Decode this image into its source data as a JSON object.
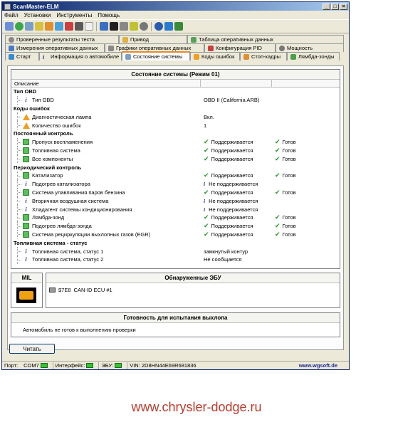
{
  "window": {
    "title": "ScanMaster-ELM",
    "min": "_",
    "max": "□",
    "close": "×"
  },
  "menu": [
    "Файл",
    "Установки",
    "Инструменты",
    "Помощь"
  ],
  "tabs_row1": [
    "Проверенные результаты теста",
    "Привод",
    "Таблица оперативных данных"
  ],
  "tabs_row2": [
    "Измерения оперативных данных",
    "Графики оперативных данных",
    "Конфигурация PID",
    "Мощность"
  ],
  "tabs_row3": [
    "Старт",
    "Информация о автомобиле",
    "Состояние системы",
    "Коды ошибок",
    "Стоп-кадры",
    "Лямбда-зонды"
  ],
  "status": {
    "header": "Состояние системы (Режим 01)",
    "col_desc": "Описание",
    "groups": [
      {
        "title": "Тип OBD",
        "rows": [
          {
            "icon": "info",
            "label": "Тип OBD",
            "value": "OBD II (California ARB)",
            "v_ok": false,
            "status": ""
          }
        ]
      },
      {
        "title": "Коды ошибок",
        "rows": [
          {
            "icon": "warn",
            "label": "Диагностическая лампа",
            "value": "Вкл.",
            "v_ok": false,
            "status": ""
          },
          {
            "icon": "warn",
            "label": "Количество ошибок",
            "value": "1",
            "v_ok": false,
            "status": ""
          }
        ]
      },
      {
        "title": "Постоянный контроль",
        "rows": [
          {
            "icon": "ok",
            "label": "Пропуск воспламенения",
            "value": "Поддерживается",
            "v_ok": true,
            "status": "Готов"
          },
          {
            "icon": "ok",
            "label": "Топливная система",
            "value": "Поддерживается",
            "v_ok": true,
            "status": "Готов"
          },
          {
            "icon": "ok",
            "label": "Все компоненты",
            "value": "Поддерживается",
            "v_ok": true,
            "status": "Готов"
          }
        ]
      },
      {
        "title": "Периодический контроль",
        "rows": [
          {
            "icon": "ok",
            "label": "Катализатор",
            "value": "Поддерживается",
            "v_ok": true,
            "status": "Готов"
          },
          {
            "icon": "info",
            "label": "Подогрев катализатора",
            "value": "Не поддерживается",
            "v_ok": "info",
            "status": ""
          },
          {
            "icon": "ok",
            "label": "Система улавливания паров бензина",
            "value": "Поддерживается",
            "v_ok": true,
            "status": "Готов"
          },
          {
            "icon": "info",
            "label": "Вторичная воздушная система",
            "value": "Не поддерживается",
            "v_ok": "info",
            "status": ""
          },
          {
            "icon": "info",
            "label": "Хладагент системы кондиционирования",
            "value": "Не поддерживается",
            "v_ok": "info",
            "status": ""
          },
          {
            "icon": "ok",
            "label": "Лямбда-зонд",
            "value": "Поддерживается",
            "v_ok": true,
            "status": "Готов"
          },
          {
            "icon": "ok",
            "label": "Подогрев лямбда-зонда",
            "value": "Поддерживается",
            "v_ok": true,
            "status": "Готов"
          },
          {
            "icon": "ok",
            "label": "Система рециркуляции выхлопных газов (EGR)",
            "value": "Поддерживается",
            "v_ok": true,
            "status": "Готов"
          }
        ]
      },
      {
        "title": "Топливная система - статус",
        "rows": [
          {
            "icon": "info",
            "label": "Топливная система, статус 1",
            "value": "замкнутый контур",
            "v_ok": false,
            "status": ""
          },
          {
            "icon": "info",
            "label": "Топливная система, статус 2",
            "value": "Не сообщается",
            "v_ok": false,
            "status": ""
          }
        ]
      }
    ]
  },
  "mil": {
    "label": "MIL"
  },
  "ecu": {
    "header": "Обнаруженные ЭБУ",
    "id": "$7E8",
    "name": "CAN-ID ECU #1"
  },
  "readiness": {
    "header": "Готовность для испытания выхлопа",
    "text": "Автомобиль не готов к выполнению проверки"
  },
  "read_button": "Читать",
  "statusbar": {
    "port_label": "Порт:",
    "port": "COM7",
    "iface_label": "Интерфейс:",
    "ecu_label": "ЭБУ:",
    "vin": "VIN: 2D8HN44E69R681836",
    "site": "www.wgsoft.de"
  },
  "watermark": "www.chrysler-dodge.ru",
  "colors": {
    "accent_tab": "#e68b2c",
    "ok_green": "#2a9a2a",
    "title_blue": "#0a246a"
  }
}
